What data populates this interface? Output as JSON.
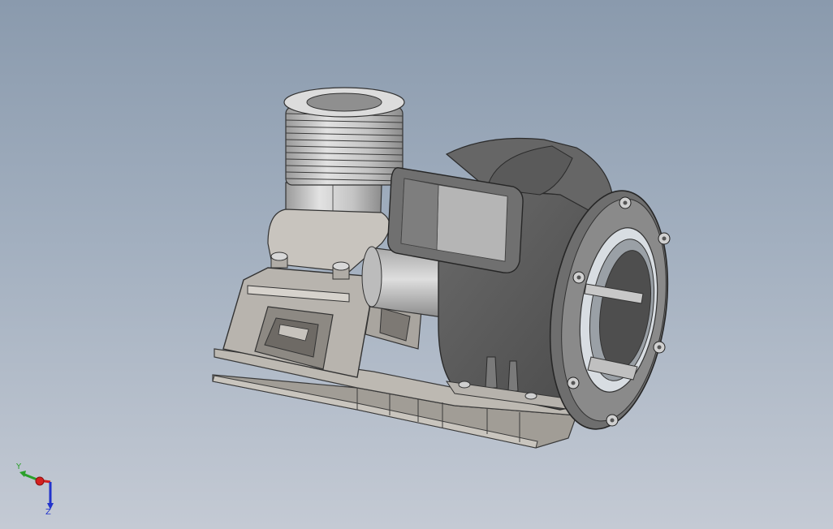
{
  "viewport": {
    "background_top": "#8a9aad",
    "background_bottom": "#c4cad4"
  },
  "triad": {
    "y_label": "Y",
    "z_label": "Z",
    "y_color": "#2aa02a",
    "z_color": "#2233cc",
    "x_color": "#d42020"
  },
  "model": {
    "body_color": "#5c5c5c",
    "frame_color": "#b8b4ae",
    "cylinder_color": "#c8c8c8"
  }
}
